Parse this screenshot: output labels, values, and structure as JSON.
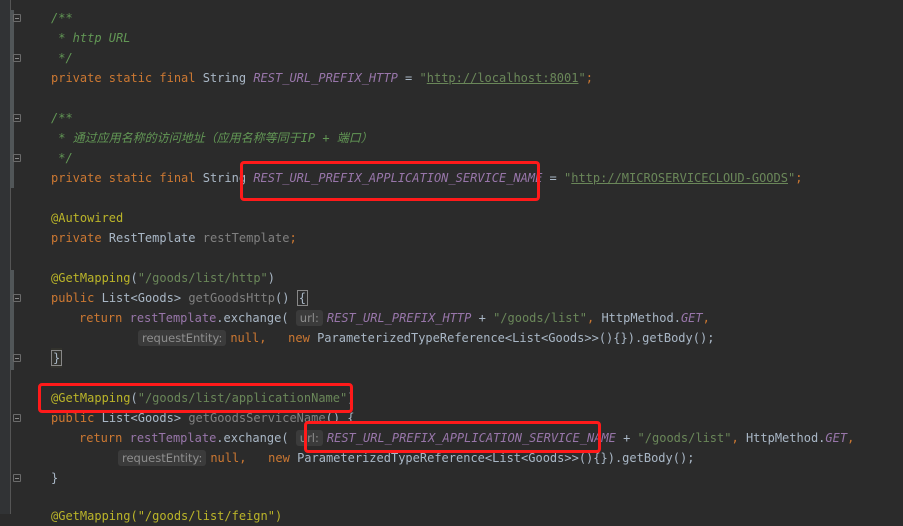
{
  "editor": {
    "lines": {
      "c1_open": "/**",
      "c1_body": " * http URL",
      "c1_close": " */",
      "f1_kw": "private static final",
      "f1_type": "String",
      "f1_name": "REST_URL_PREFIX_HTTP",
      "f1_eq": " = ",
      "f1_val": "http://localhost:8001",
      "c2_open": "/**",
      "c2_body": " * 通过应用名称的访问地址（应用名称等同于IP + 端口）",
      "c2_close": " */",
      "f2_kw": "private static final",
      "f2_type": "String",
      "f2_name": "REST_URL_PREFIX_APPLICATION_SERVICE_NAME",
      "f2_eq": " = ",
      "f2_val": "http://MICROSERVICECLOUD-GOODS",
      "autowired": "@Autowired",
      "f3_kw": "private",
      "f3_type": "RestTemplate",
      "f3_name": "restTemplate",
      "m1_ann": "@GetMapping",
      "m1_path": "\"/goods/list/http\"",
      "m1_kw": "public",
      "m1_ret": "List<Goods>",
      "m1_name": "getGoodsHttp",
      "m1_ret_kw": "return",
      "m1_call_obj": "restTemplate",
      "m1_call": ".exchange(",
      "m1_hint_url": "url:",
      "m1_const": "REST_URL_PREFIX_HTTP",
      "m1_plus": " + ",
      "m1_str": "\"/goods/list\"",
      "m1_method": "HttpMethod.",
      "m1_get": "GET",
      "m1_hint_entity": "requestEntity:",
      "m1_null": "null,",
      "m1_new": "new",
      "m1_tail": "ParameterizedTypeReference<List<Goods>>(){}).getBody();",
      "m2_ann": "@GetMapping",
      "m2_path": "\"/goods/list/applicationName\"",
      "m2_kw": "public",
      "m2_ret": "List<Goods>",
      "m2_name": "getGoodsServiceName",
      "m2_ret_kw": "return",
      "m2_call_obj": "restTemplate",
      "m2_call": ".exchange(",
      "m2_hint_url": "url:",
      "m2_const": "REST_URL_PREFIX_APPLICATION_SERVICE_NAME",
      "m2_plus": " + ",
      "m2_str": "\"/goods/list\"",
      "m2_method": "HttpMethod.",
      "m2_get": "GET",
      "m2_hint_entity": "requestEntity:",
      "m2_null": "null,",
      "m2_new": "new",
      "m2_tail": "ParameterizedTypeReference<List<Goods>>(){}).getBody();",
      "m3_partial": "@GetMapping(\"/goods/list/feign\")"
    }
  },
  "colors": {
    "background": "#2b2b2b",
    "keyword": "#cc7832",
    "comment": "#629755",
    "constant": "#9876aa",
    "string": "#6a8759",
    "annotation": "#bbb529",
    "method": "#ffc66d",
    "highlight_box": "#ff1a1a"
  }
}
